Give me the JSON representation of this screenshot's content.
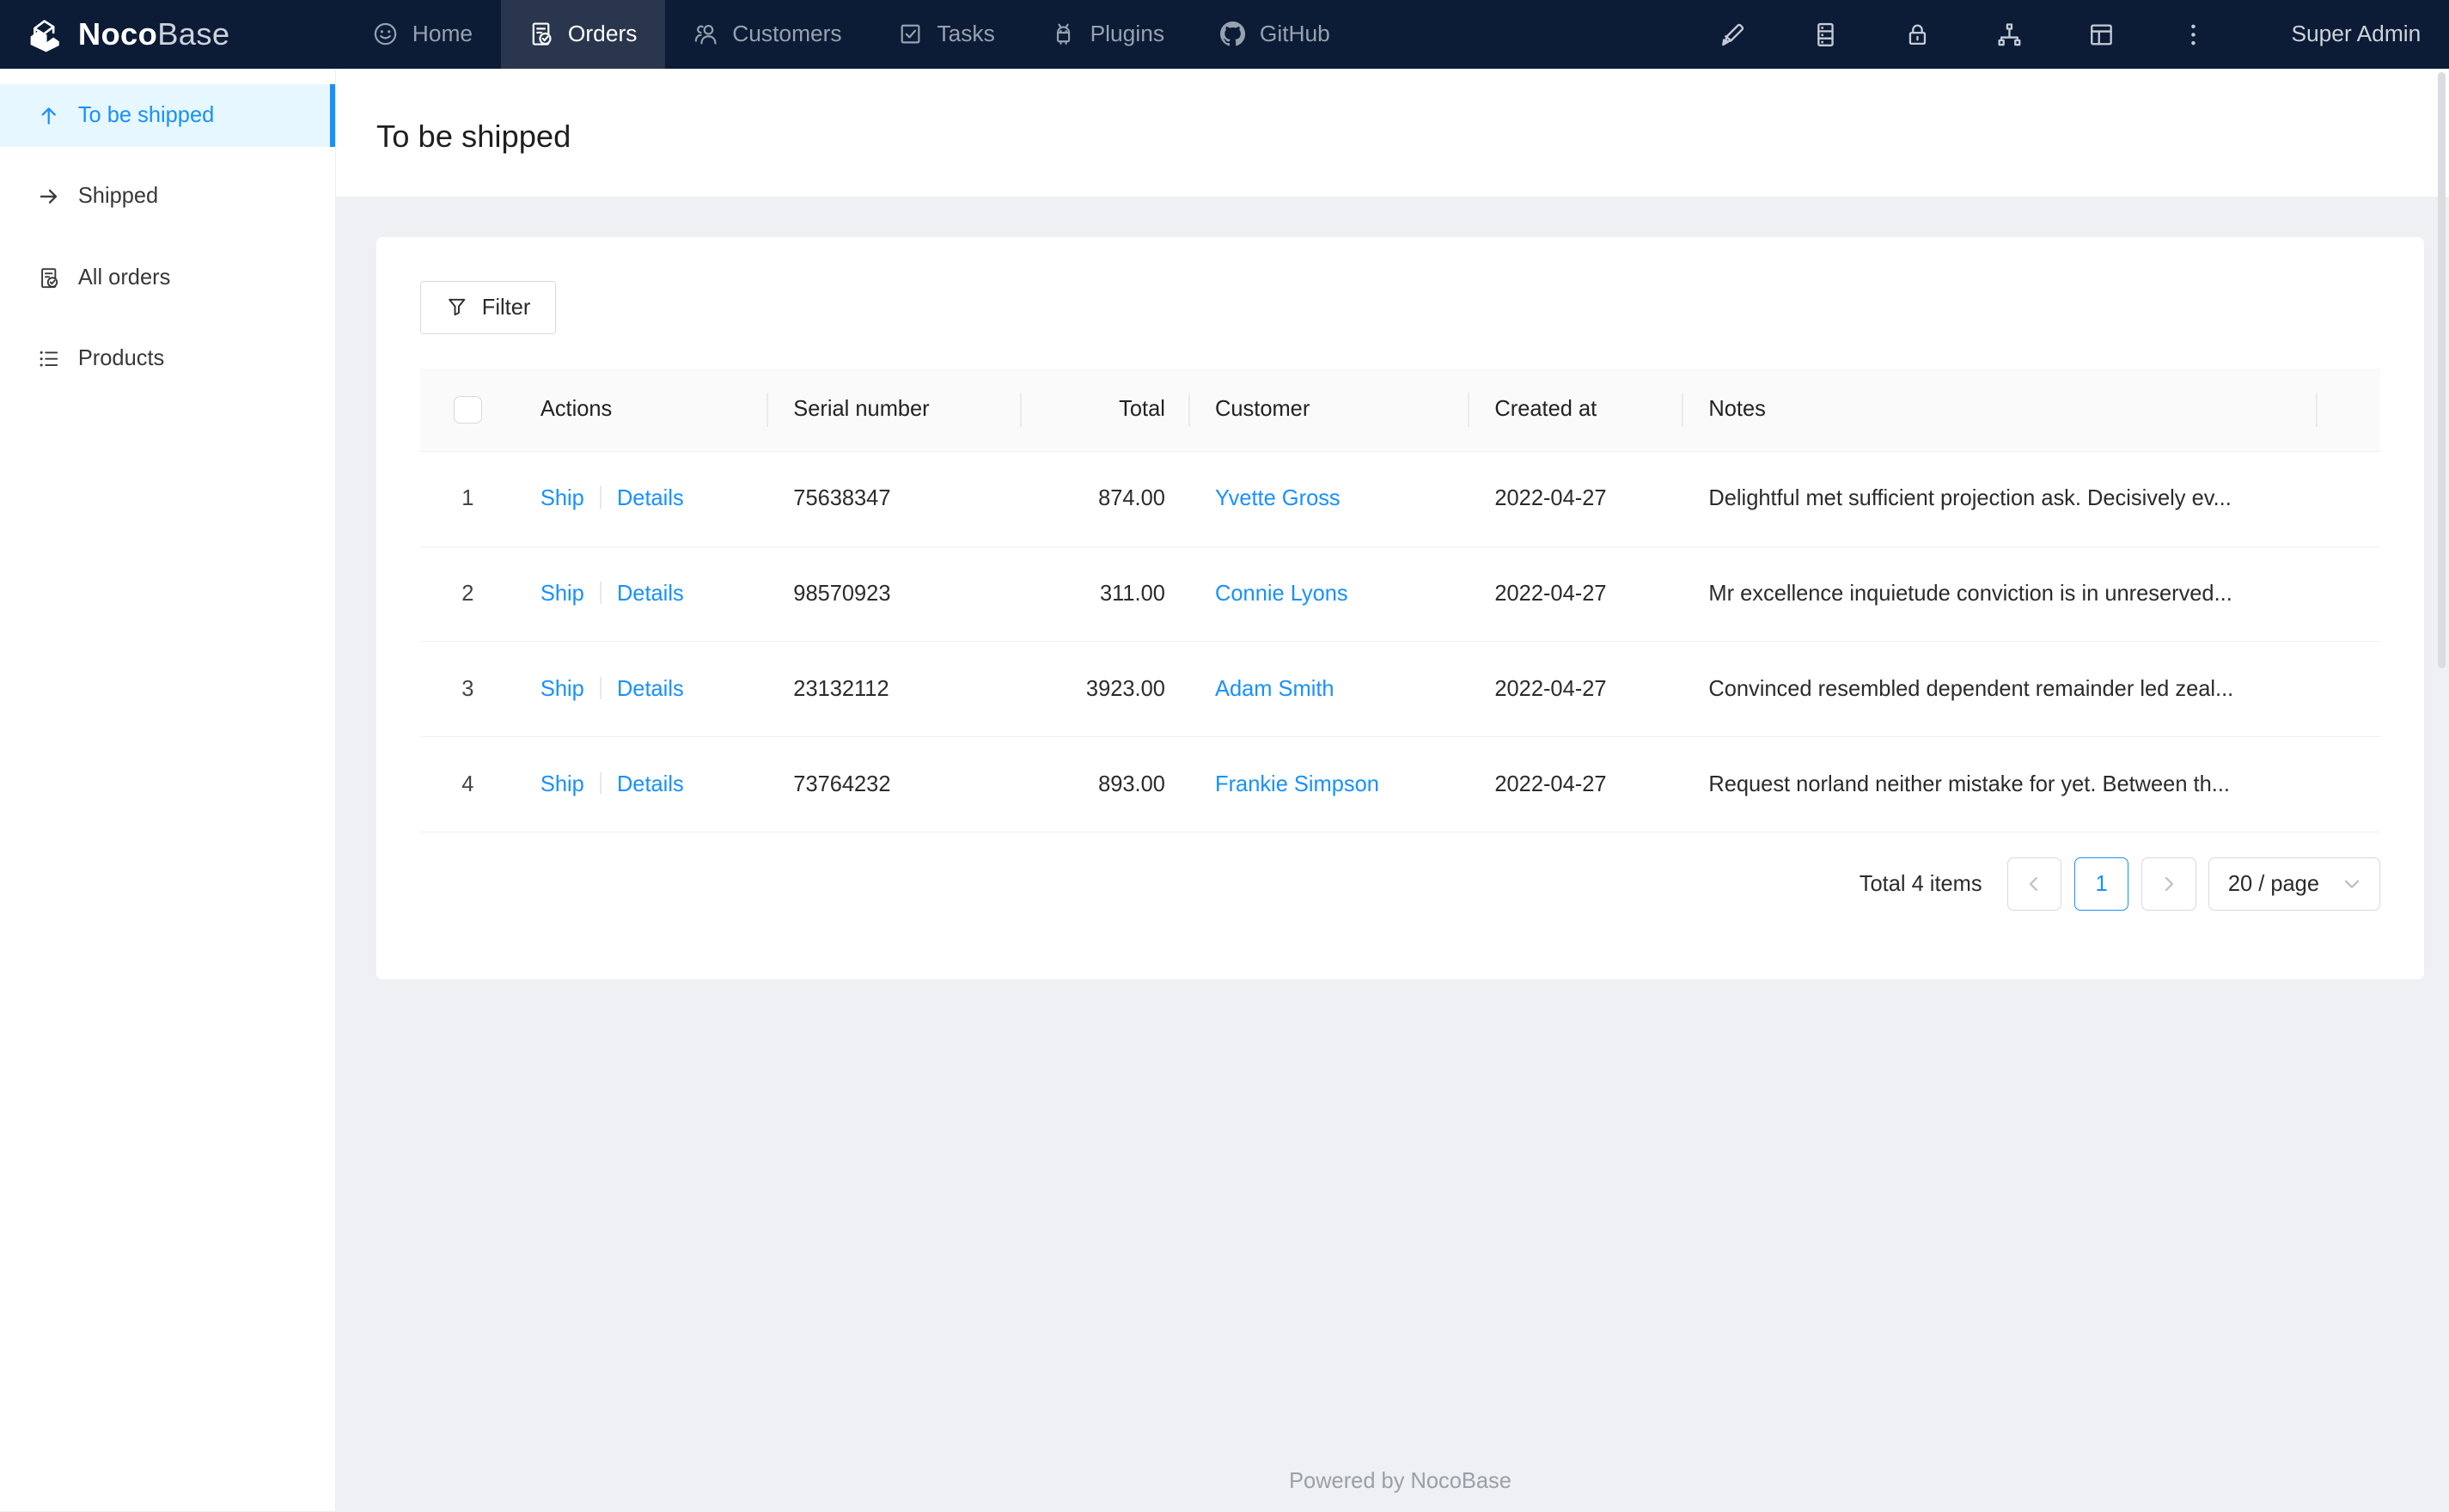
{
  "navbar": {
    "logo": {
      "bold": "Noco",
      "light": "Base"
    },
    "items": [
      {
        "label": "Home",
        "icon": "smile-icon",
        "active": false
      },
      {
        "label": "Orders",
        "icon": "file-done-icon",
        "active": true
      },
      {
        "label": "Customers",
        "icon": "team-icon",
        "active": false
      },
      {
        "label": "Tasks",
        "icon": "check-square-icon",
        "active": false
      },
      {
        "label": "Plugins",
        "icon": "robot-icon",
        "active": false
      },
      {
        "label": "GitHub",
        "icon": "github-icon",
        "active": false
      }
    ],
    "action_icons": [
      "highlighter-icon",
      "database-icon",
      "lock-icon",
      "apartment-icon",
      "layout-icon",
      "more-vertical-icon"
    ],
    "user": "Super Admin"
  },
  "sidebar": {
    "items": [
      {
        "label": "To be shipped",
        "icon": "arrow-up-icon",
        "active": true
      },
      {
        "label": "Shipped",
        "icon": "arrow-right-icon",
        "active": false
      },
      {
        "label": "All orders",
        "icon": "file-done-icon",
        "active": false
      },
      {
        "label": "Products",
        "icon": "unordered-list-icon",
        "active": false
      }
    ]
  },
  "page": {
    "title": "To be shipped"
  },
  "toolbar": {
    "filter_label": "Filter"
  },
  "table": {
    "columns": [
      "Actions",
      "Serial number",
      "Total",
      "Customer",
      "Created at",
      "Notes"
    ],
    "rows": [
      {
        "index": "1",
        "ship": "Ship",
        "details": "Details",
        "serial": "75638347",
        "total": "874.00",
        "customer": "Yvette Gross",
        "created_at": "2022-04-27",
        "notes": "Delightful met sufficient projection ask. Decisively ev..."
      },
      {
        "index": "2",
        "ship": "Ship",
        "details": "Details",
        "serial": "98570923",
        "total": "311.00",
        "customer": "Connie Lyons",
        "created_at": "2022-04-27",
        "notes": "Mr excellence inquietude conviction is in unreserved..."
      },
      {
        "index": "3",
        "ship": "Ship",
        "details": "Details",
        "serial": "23132112",
        "total": "3923.00",
        "customer": "Adam Smith",
        "created_at": "2022-04-27",
        "notes": "Convinced resembled dependent remainder led zeal..."
      },
      {
        "index": "4",
        "ship": "Ship",
        "details": "Details",
        "serial": "73764232",
        "total": "893.00",
        "customer": "Frankie Simpson",
        "created_at": "2022-04-27",
        "notes": "Request norland neither mistake for yet. Between th..."
      }
    ]
  },
  "pagination": {
    "total_text": "Total 4 items",
    "current_page": "1",
    "page_size": "20 / page"
  },
  "footer": {
    "text": "Powered by NocoBase"
  },
  "colors": {
    "primary": "#1890ff",
    "navbar_bg": "#0c1c36",
    "navbar_active_bg": "#29364d",
    "sidebar_active_bg": "#e6f7ff",
    "body_bg": "#eef0f3"
  }
}
